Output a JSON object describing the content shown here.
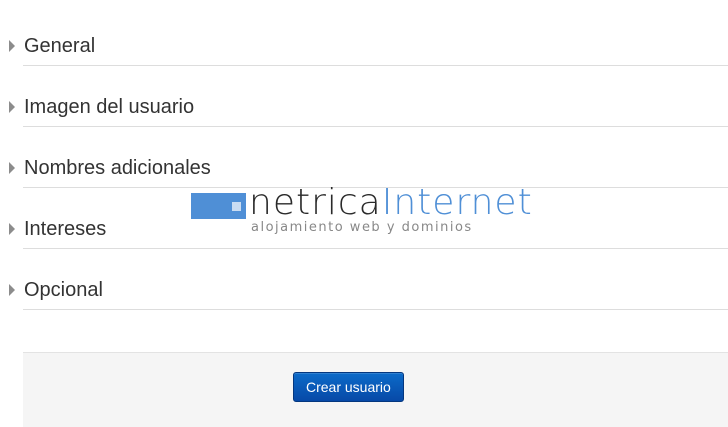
{
  "sections": [
    {
      "title": "General"
    },
    {
      "title": "Imagen del usuario"
    },
    {
      "title": "Nombres adicionales"
    },
    {
      "title": "Intereses"
    },
    {
      "title": "Opcional"
    }
  ],
  "actions": {
    "submit_label": "Crear usuario"
  },
  "watermark": {
    "brand_part1": "netrica",
    "brand_part2": "Internet",
    "tagline": "alojamiento web y dominios"
  },
  "colors": {
    "button": "#0a5cbf",
    "brand_blue": "#4f8fd6"
  }
}
